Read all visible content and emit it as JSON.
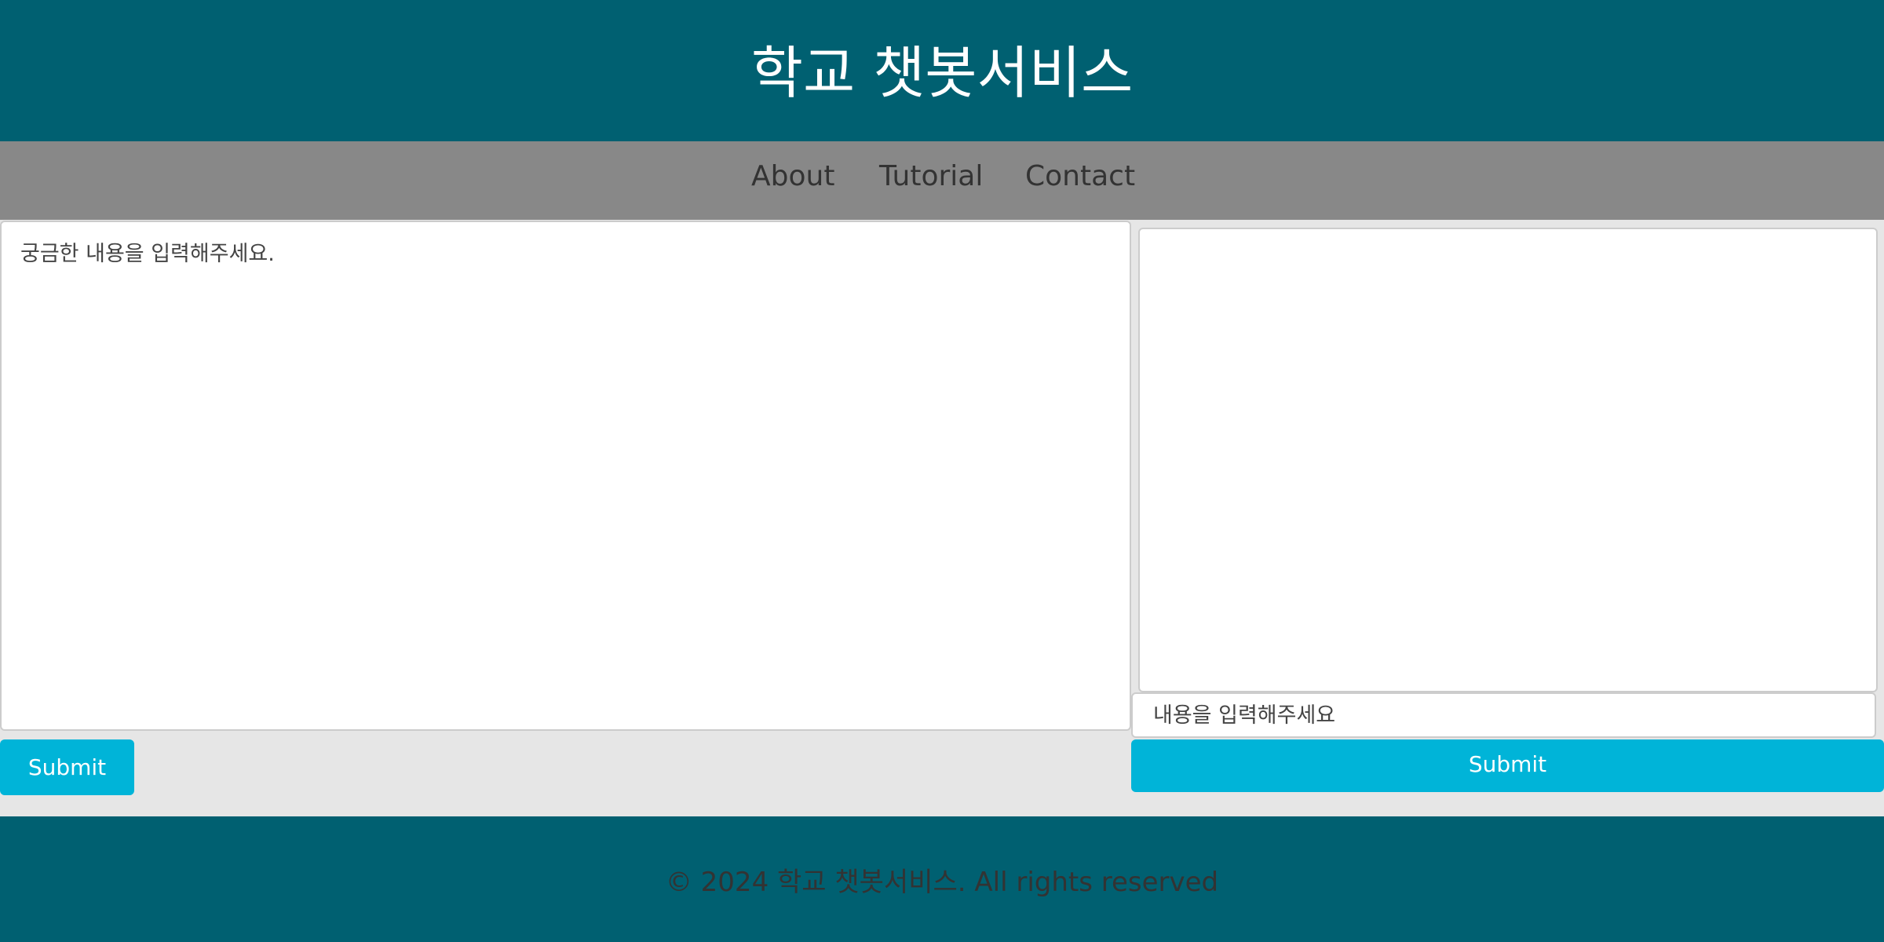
{
  "header": {
    "title": "학교 챗봇서비스"
  },
  "nav": {
    "items": [
      {
        "label": "About"
      },
      {
        "label": "Tutorial"
      },
      {
        "label": "Contact"
      }
    ]
  },
  "left_panel": {
    "textarea_placeholder": "궁금한 내용을 입력해주세요.",
    "submit_label": "Submit"
  },
  "right_panel": {
    "input_placeholder": "내용을 입력해주세요",
    "submit_label": "Submit"
  },
  "footer": {
    "text": "© 2024 학교 챗봇서비스. All rights reserved"
  },
  "colors": {
    "header_bg": "#006071",
    "nav_bg": "#888888",
    "page_bg": "#e6e6e6",
    "button_bg": "#00b4d8"
  }
}
